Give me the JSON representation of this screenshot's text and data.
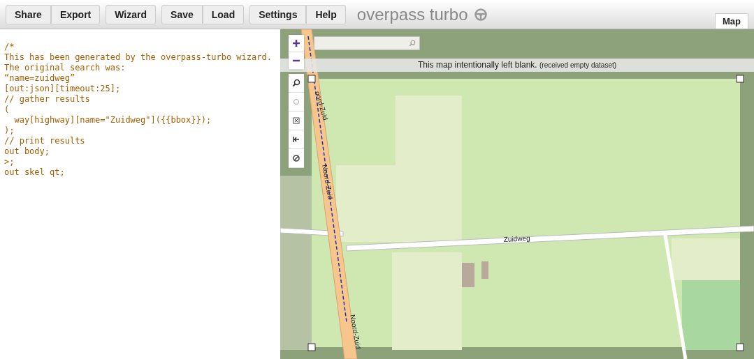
{
  "toolbar": {
    "groups": [
      {
        "buttons": [
          {
            "label": "Share"
          },
          {
            "label": "Export"
          }
        ]
      },
      {
        "buttons": [
          {
            "label": "Wizard"
          }
        ]
      },
      {
        "buttons": [
          {
            "label": "Save"
          },
          {
            "label": "Load"
          }
        ]
      },
      {
        "buttons": [
          {
            "label": "Settings"
          },
          {
            "label": "Help"
          }
        ]
      }
    ],
    "app_title": "overpass turbo"
  },
  "view_tabs": [
    {
      "label": "Map",
      "selected": true
    }
  ],
  "editor": {
    "lines": [
      "/*",
      "This has been generated by the overpass-turbo wizard.",
      "The original search was:",
      "“name=zuidweg”",
      "[out:json][timeout:25];",
      "// gather results",
      "(",
      "  way[highway][name=\"Zuidweg\"]({{bbox}});",
      ");",
      "// print results",
      "out body;",
      ">;",
      "out skel qt;"
    ]
  },
  "map": {
    "banner": {
      "text": "This map intentionally left blank.",
      "note": "(received empty dataset)"
    },
    "road_labels": [
      {
        "text": "oord-Zuid",
        "kind": "vertical"
      },
      {
        "text": "Noord-Zuid",
        "kind": "vertical"
      },
      {
        "text": "Zuidweg",
        "kind": "horizontal"
      },
      {
        "text": "Noord-Zuid",
        "kind": "vertical"
      }
    ]
  }
}
